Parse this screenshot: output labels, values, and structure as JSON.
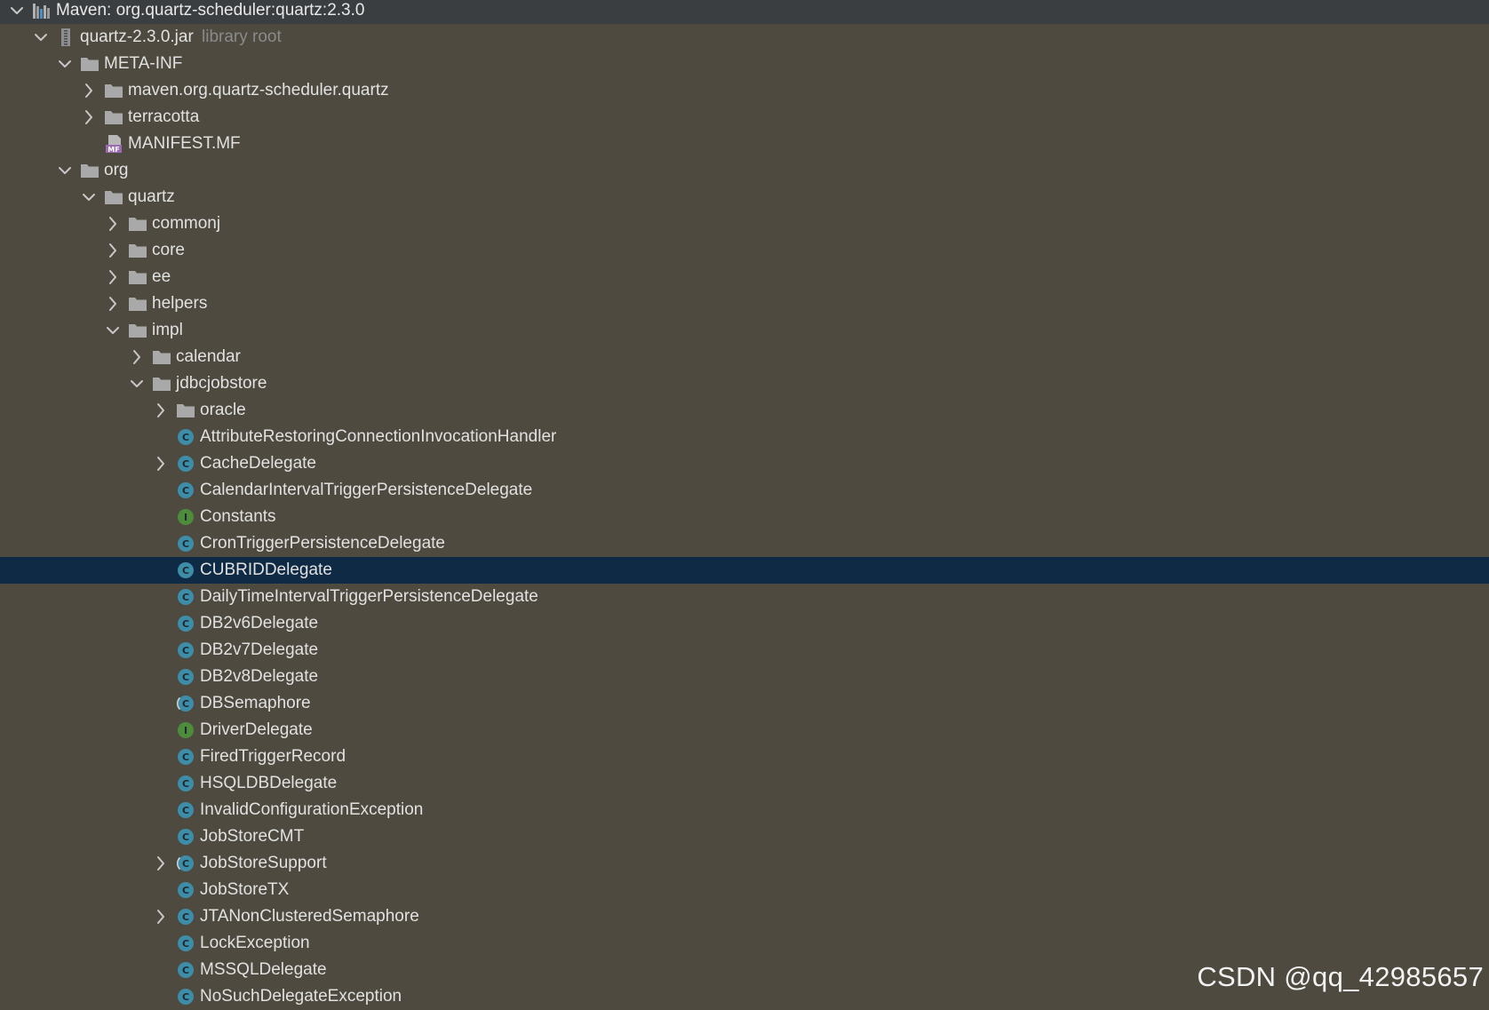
{
  "colors": {
    "background": "#4e4a3f",
    "header_bar": "#3b3e40",
    "selected_row": "#0e2a44",
    "class_icon": "#3d8ca8",
    "interface_icon": "#4e8c3b",
    "folder_icon": "#a9a9a9"
  },
  "tree": [
    {
      "label": "Maven: org.quartz-scheduler:quartz:2.3.0",
      "depth": 0,
      "arrow": "expanded",
      "icon": "maven-library-icon",
      "header": true
    },
    {
      "label": "quartz-2.3.0.jar",
      "suffix": "library root",
      "depth": 1,
      "arrow": "expanded",
      "icon": "jar-archive-icon"
    },
    {
      "label": "META-INF",
      "depth": 2,
      "arrow": "expanded",
      "icon": "folder-icon"
    },
    {
      "label": "maven.org.quartz-scheduler.quartz",
      "depth": 3,
      "arrow": "collapsed",
      "icon": "folder-icon"
    },
    {
      "label": "terracotta",
      "depth": 3,
      "arrow": "collapsed",
      "icon": "folder-icon"
    },
    {
      "label": "MANIFEST.MF",
      "depth": 3,
      "arrow": "none",
      "icon": "manifest-file-icon"
    },
    {
      "label": "org",
      "depth": 2,
      "arrow": "expanded",
      "icon": "folder-icon"
    },
    {
      "label": "quartz",
      "depth": 3,
      "arrow": "expanded",
      "icon": "folder-icon"
    },
    {
      "label": "commonj",
      "depth": 4,
      "arrow": "collapsed",
      "icon": "folder-icon"
    },
    {
      "label": "core",
      "depth": 4,
      "arrow": "collapsed",
      "icon": "folder-icon"
    },
    {
      "label": "ee",
      "depth": 4,
      "arrow": "collapsed",
      "icon": "folder-icon"
    },
    {
      "label": "helpers",
      "depth": 4,
      "arrow": "collapsed",
      "icon": "folder-icon"
    },
    {
      "label": "impl",
      "depth": 4,
      "arrow": "expanded",
      "icon": "folder-icon"
    },
    {
      "label": "calendar",
      "depth": 5,
      "arrow": "collapsed",
      "icon": "folder-icon"
    },
    {
      "label": "jdbcjobstore",
      "depth": 5,
      "arrow": "expanded",
      "icon": "folder-icon"
    },
    {
      "label": "oracle",
      "depth": 6,
      "arrow": "collapsed",
      "icon": "folder-icon"
    },
    {
      "label": "AttributeRestoringConnectionInvocationHandler",
      "depth": 6,
      "arrow": "none",
      "icon": "class-icon"
    },
    {
      "label": "CacheDelegate",
      "depth": 6,
      "arrow": "collapsed",
      "icon": "class-icon"
    },
    {
      "label": "CalendarIntervalTriggerPersistenceDelegate",
      "depth": 6,
      "arrow": "none",
      "icon": "class-icon"
    },
    {
      "label": "Constants",
      "depth": 6,
      "arrow": "none",
      "icon": "interface-icon"
    },
    {
      "label": "CronTriggerPersistenceDelegate",
      "depth": 6,
      "arrow": "none",
      "icon": "class-icon"
    },
    {
      "label": "CUBRIDDelegate",
      "depth": 6,
      "arrow": "none",
      "icon": "class-icon",
      "selected": true
    },
    {
      "label": "DailyTimeIntervalTriggerPersistenceDelegate",
      "depth": 6,
      "arrow": "none",
      "icon": "class-icon"
    },
    {
      "label": "DB2v6Delegate",
      "depth": 6,
      "arrow": "none",
      "icon": "class-icon"
    },
    {
      "label": "DB2v7Delegate",
      "depth": 6,
      "arrow": "none",
      "icon": "class-icon"
    },
    {
      "label": "DB2v8Delegate",
      "depth": 6,
      "arrow": "none",
      "icon": "class-icon"
    },
    {
      "label": "DBSemaphore",
      "depth": 6,
      "arrow": "none",
      "icon": "abstract-class-icon"
    },
    {
      "label": "DriverDelegate",
      "depth": 6,
      "arrow": "none",
      "icon": "interface-icon"
    },
    {
      "label": "FiredTriggerRecord",
      "depth": 6,
      "arrow": "none",
      "icon": "class-icon"
    },
    {
      "label": "HSQLDBDelegate",
      "depth": 6,
      "arrow": "none",
      "icon": "class-icon"
    },
    {
      "label": "InvalidConfigurationException",
      "depth": 6,
      "arrow": "none",
      "icon": "class-icon"
    },
    {
      "label": "JobStoreCMT",
      "depth": 6,
      "arrow": "none",
      "icon": "class-icon"
    },
    {
      "label": "JobStoreSupport",
      "depth": 6,
      "arrow": "collapsed",
      "icon": "abstract-class-icon"
    },
    {
      "label": "JobStoreTX",
      "depth": 6,
      "arrow": "none",
      "icon": "class-icon"
    },
    {
      "label": "JTANonClusteredSemaphore",
      "depth": 6,
      "arrow": "collapsed",
      "icon": "class-icon"
    },
    {
      "label": "LockException",
      "depth": 6,
      "arrow": "none",
      "icon": "class-icon"
    },
    {
      "label": "MSSQLDelegate",
      "depth": 6,
      "arrow": "none",
      "icon": "class-icon"
    },
    {
      "label": "NoSuchDelegateException",
      "depth": 6,
      "arrow": "none",
      "icon": "class-icon"
    }
  ],
  "watermark": "CSDN @qq_42985657"
}
